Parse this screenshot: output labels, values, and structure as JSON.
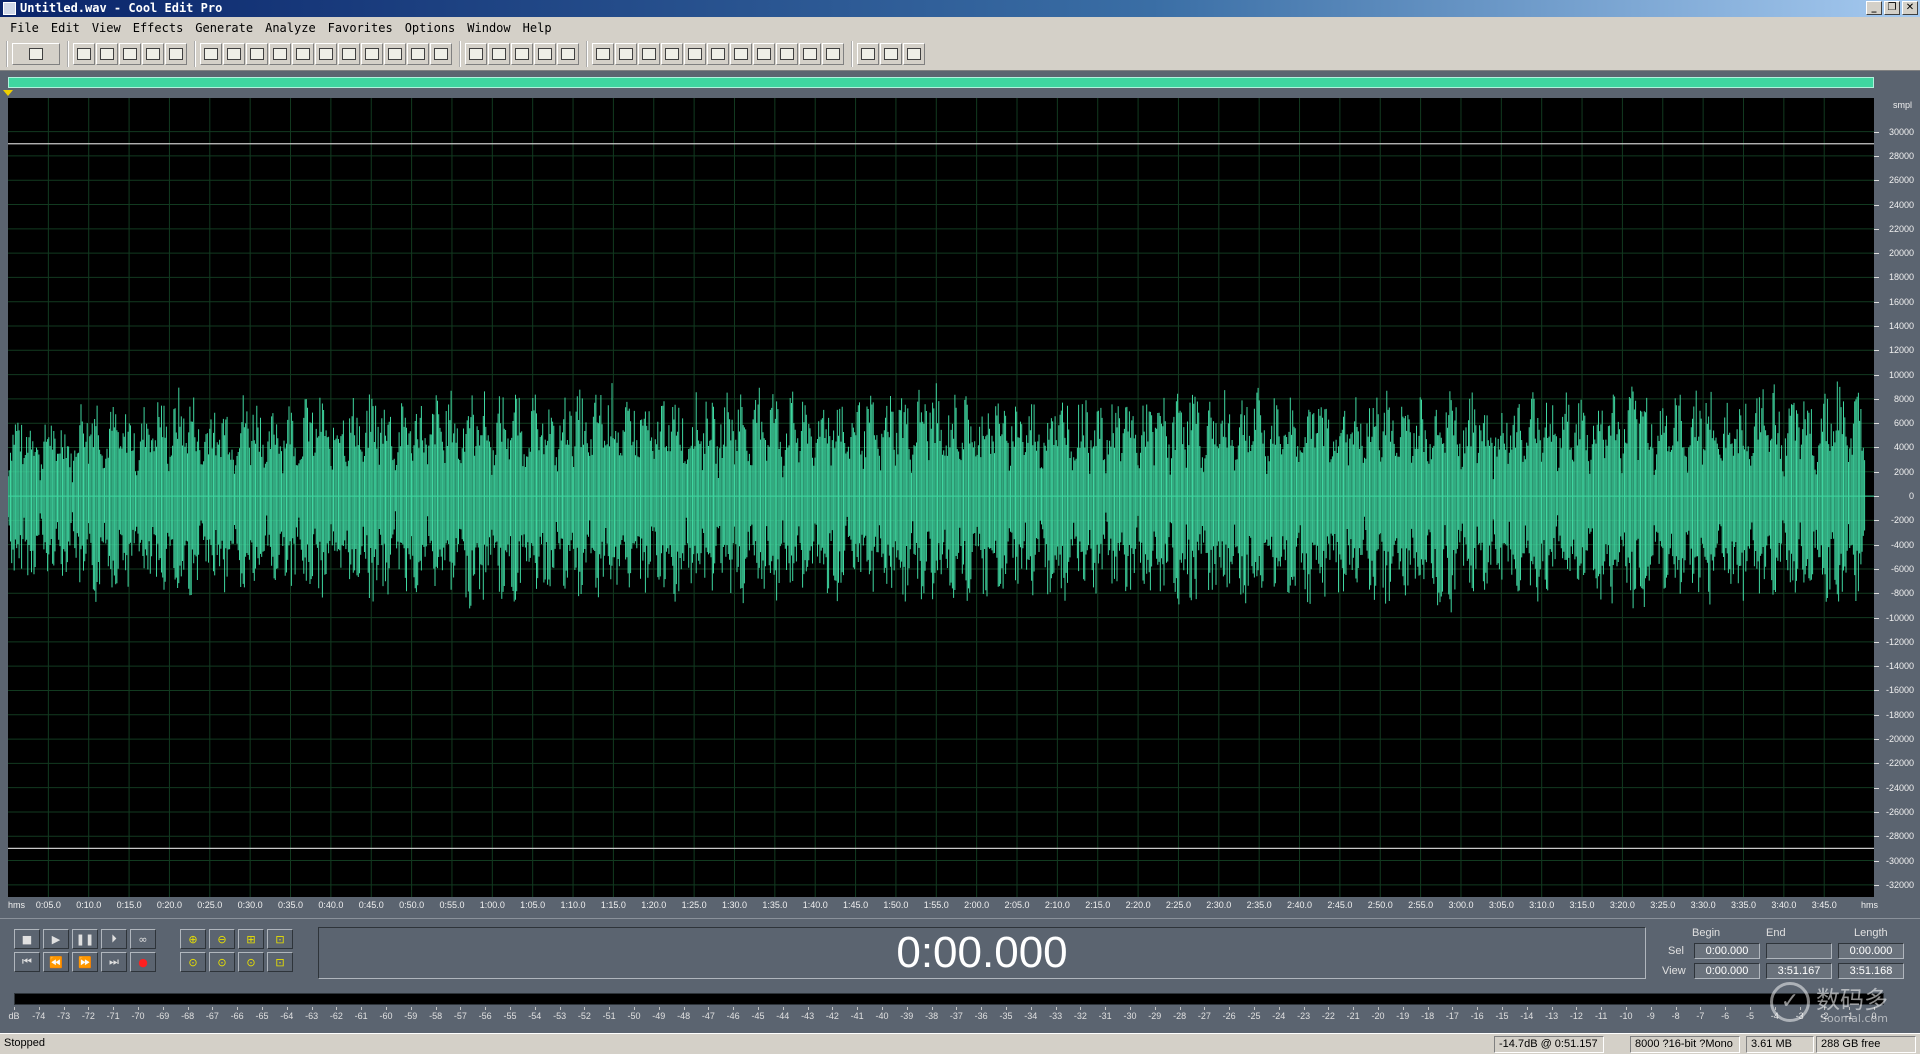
{
  "window": {
    "title": "Untitled.wav - Cool Edit Pro",
    "controls": [
      "_",
      "❐",
      "✕"
    ]
  },
  "menu": [
    "File",
    "Edit",
    "View",
    "Effects",
    "Generate",
    "Analyze",
    "Favorites",
    "Options",
    "Window",
    "Help"
  ],
  "toolbar": {
    "groups": [
      [
        "multitrack-toggle-icon"
      ],
      [
        "new-file-icon",
        "open-file-icon",
        "save-icon",
        "save-all-icon",
        "close-icon"
      ],
      [
        "undo-icon",
        "redo-icon",
        "repeat-last-icon",
        "copy-new-icon",
        "paste-new-icon",
        "cut-icon",
        "copy-icon",
        "paste-icon",
        "mix-paste-icon",
        "trim-icon",
        "ripple-delete-icon"
      ],
      [
        "envelope-icon",
        "waveform-icon",
        "spectral-view-icon",
        "spectral-pan-icon",
        "spectral-phase-icon"
      ],
      [
        "cue-list-icon",
        "play-list-icon",
        "info-icon",
        "preview-icon",
        "frequency-analysis-icon",
        "time-display-icon",
        "level-meter-icon",
        "snap-icon",
        "settings-icon",
        "scripts-icon",
        "help-icon"
      ],
      [
        "tools-icon",
        "properties-icon",
        "context-help-icon"
      ]
    ]
  },
  "ruler_y": {
    "unit": "smpl",
    "labels": [
      "30000",
      "28000",
      "26000",
      "24000",
      "22000",
      "20000",
      "18000",
      "16000",
      "14000",
      "12000",
      "10000",
      "8000",
      "6000",
      "4000",
      "2000",
      "0",
      "-2000",
      "-4000",
      "-6000",
      "-8000",
      "-10000",
      "-12000",
      "-14000",
      "-16000",
      "-18000",
      "-20000",
      "-22000",
      "-24000",
      "-26000",
      "-28000",
      "-30000",
      "-32000"
    ],
    "values": [
      30000,
      28000,
      26000,
      24000,
      22000,
      20000,
      18000,
      16000,
      14000,
      12000,
      10000,
      8000,
      6000,
      4000,
      2000,
      0,
      -2000,
      -4000,
      -6000,
      -8000,
      -10000,
      -12000,
      -14000,
      -16000,
      -18000,
      -20000,
      -22000,
      -24000,
      -26000,
      -28000,
      -30000,
      -32000
    ],
    "range": [
      -33000,
      32768
    ]
  },
  "ruler_x": {
    "start_label": "hms",
    "end_label": "hms",
    "labels": [
      "0:05.0",
      "0:10.0",
      "0:15.0",
      "0:20.0",
      "0:25.0",
      "0:30.0",
      "0:35.0",
      "0:40.0",
      "0:45.0",
      "0:50.0",
      "0:55.0",
      "1:00.0",
      "1:05.0",
      "1:10.0",
      "1:15.0",
      "1:20.0",
      "1:25.0",
      "1:30.0",
      "1:35.0",
      "1:40.0",
      "1:45.0",
      "1:50.0",
      "1:55.0",
      "2:00.0",
      "2:05.0",
      "2:10.0",
      "2:15.0",
      "2:20.0",
      "2:25.0",
      "2:30.0",
      "2:35.0",
      "2:40.0",
      "2:45.0",
      "2:50.0",
      "2:55.0",
      "3:00.0",
      "3:05.0",
      "3:10.0",
      "3:15.0",
      "3:20.0",
      "3:25.0",
      "3:30.0",
      "3:35.0",
      "3:40.0",
      "3:45.0"
    ],
    "seconds": [
      5,
      10,
      15,
      20,
      25,
      30,
      35,
      40,
      45,
      50,
      55,
      60,
      65,
      70,
      75,
      80,
      85,
      90,
      95,
      100,
      105,
      110,
      115,
      120,
      125,
      130,
      135,
      140,
      145,
      150,
      155,
      160,
      165,
      170,
      175,
      180,
      185,
      190,
      195,
      200,
      205,
      210,
      215,
      220,
      225
    ],
    "duration_seconds": 231.168
  },
  "waveform": {
    "colors": {
      "wave": "#3fd6a0",
      "background": "#000000",
      "grid": "#123a20",
      "limit_line": "#c8c8c8",
      "overview": "#3fd6a0"
    },
    "clip_lines": [
      29000,
      -29000
    ],
    "peak_envelope": [
      [
        0,
        6500
      ],
      [
        2,
        8200
      ],
      [
        4,
        6000
      ],
      [
        6,
        7800
      ],
      [
        8,
        5500
      ],
      [
        10,
        10800
      ],
      [
        12,
        7000
      ],
      [
        14,
        8600
      ],
      [
        16,
        6200
      ],
      [
        18,
        10000
      ],
      [
        20,
        7500
      ],
      [
        22,
        10500
      ],
      [
        24,
        6800
      ],
      [
        26,
        9000
      ],
      [
        28,
        7200
      ],
      [
        30,
        10200
      ],
      [
        32,
        6600
      ],
      [
        34,
        8800
      ],
      [
        36,
        7400
      ],
      [
        38,
        9800
      ],
      [
        40,
        6900
      ],
      [
        42,
        9400
      ],
      [
        44,
        7600
      ],
      [
        46,
        10400
      ],
      [
        48,
        7000
      ],
      [
        50,
        9600
      ],
      [
        52,
        7300
      ],
      [
        54,
        9900
      ],
      [
        56,
        7800
      ],
      [
        58,
        10600
      ],
      [
        60,
        7100
      ],
      [
        62,
        10300
      ],
      [
        64,
        7700
      ],
      [
        66,
        9500
      ],
      [
        68,
        7000
      ],
      [
        70,
        10100
      ],
      [
        72,
        7400
      ],
      [
        74,
        10700
      ],
      [
        76,
        8000
      ],
      [
        78,
        9300
      ],
      [
        80,
        7200
      ],
      [
        82,
        10200
      ],
      [
        84,
        7600
      ],
      [
        86,
        9700
      ],
      [
        88,
        7300
      ],
      [
        90,
        10400
      ],
      [
        92,
        7900
      ],
      [
        94,
        11000
      ],
      [
        96,
        7500
      ],
      [
        98,
        9800
      ],
      [
        100,
        7200
      ],
      [
        102,
        10300
      ],
      [
        104,
        7700
      ],
      [
        106,
        9600
      ],
      [
        108,
        7100
      ],
      [
        110,
        10500
      ],
      [
        112,
        7800
      ],
      [
        114,
        11200
      ],
      [
        116,
        7400
      ],
      [
        118,
        9900
      ],
      [
        120,
        7300
      ],
      [
        122,
        10100
      ],
      [
        124,
        7700
      ],
      [
        126,
        9400
      ],
      [
        128,
        7200
      ],
      [
        130,
        10300
      ],
      [
        132,
        7600
      ],
      [
        134,
        9800
      ],
      [
        136,
        7100
      ],
      [
        138,
        10200
      ],
      [
        140,
        7500
      ],
      [
        142,
        9600
      ],
      [
        144,
        7800
      ],
      [
        146,
        11100
      ],
      [
        148,
        7200
      ],
      [
        150,
        9900
      ],
      [
        152,
        7600
      ],
      [
        154,
        10400
      ],
      [
        156,
        7300
      ],
      [
        158,
        9700
      ],
      [
        160,
        7900
      ],
      [
        162,
        10200
      ],
      [
        164,
        7400
      ],
      [
        166,
        9500
      ],
      [
        168,
        7100
      ],
      [
        170,
        10600
      ],
      [
        172,
        7700
      ],
      [
        174,
        9800
      ],
      [
        176,
        7300
      ],
      [
        178,
        11300
      ],
      [
        180,
        7600
      ],
      [
        182,
        10000
      ],
      [
        184,
        7200
      ],
      [
        186,
        9400
      ],
      [
        188,
        7800
      ],
      [
        190,
        10700
      ],
      [
        192,
        7400
      ],
      [
        194,
        9900
      ],
      [
        196,
        7000
      ],
      [
        198,
        10300
      ],
      [
        200,
        7600
      ],
      [
        202,
        11000
      ],
      [
        204,
        7300
      ],
      [
        206,
        9600
      ],
      [
        208,
        7800
      ],
      [
        210,
        10500
      ],
      [
        212,
        7200
      ],
      [
        214,
        9800
      ],
      [
        216,
        7500
      ],
      [
        218,
        10900
      ],
      [
        220,
        7100
      ],
      [
        222,
        9700
      ],
      [
        224,
        7600
      ],
      [
        226,
        11500
      ],
      [
        228,
        8200
      ],
      [
        230,
        9500
      ],
      [
        231.168,
        0
      ]
    ]
  },
  "transport": {
    "row1": [
      "■",
      "▶",
      "❚❚",
      "⏵",
      "∞"
    ],
    "row1_names": [
      "stop-button",
      "play-button",
      "pause-button",
      "play-to-end-button",
      "loop-button"
    ],
    "row2": [
      "⏮",
      "⏪",
      "⏩",
      "⏭",
      "●"
    ],
    "row2_names": [
      "go-to-start-button",
      "rewind-button",
      "fast-forward-button",
      "go-to-end-button",
      "record-button"
    ],
    "zoom_row1": [
      "⊕",
      "⊖",
      "⊞",
      "⊡"
    ],
    "zoom_row1_names": [
      "zoom-in-full-button",
      "zoom-out-full-button",
      "zoom-out-button",
      "zoom-in-vertical-button"
    ],
    "zoom_row2": [
      "⊙",
      "⊙",
      "⊙",
      "⊡"
    ],
    "zoom_row2_names": [
      "zoom-to-left-button",
      "zoom-to-right-button",
      "zoom-to-selection-button",
      "zoom-out-vertical-button"
    ]
  },
  "time_display": "0:00.000",
  "selection": {
    "headers": [
      "Begin",
      "End",
      "Length"
    ],
    "sel_label": "Sel",
    "view_label": "View",
    "sel": [
      "0:00.000",
      "",
      "0:00.000"
    ],
    "view": [
      "0:00.000",
      "3:51.167",
      "3:51.168"
    ]
  },
  "level_meter": {
    "labels": [
      "dB",
      "-74",
      "-73",
      "-72",
      "-71",
      "-70",
      "-69",
      "-68",
      "-67",
      "-66",
      "-65",
      "-64",
      "-63",
      "-62",
      "-61",
      "-60",
      "-59",
      "-58",
      "-57",
      "-56",
      "-55",
      "-54",
      "-53",
      "-52",
      "-51",
      "-50",
      "-49",
      "-48",
      "-47",
      "-46",
      "-45",
      "-44",
      "-43",
      "-42",
      "-41",
      "-40",
      "-39",
      "-38",
      "-37",
      "-36",
      "-35",
      "-34",
      "-33",
      "-32",
      "-31",
      "-30",
      "-29",
      "-28",
      "-27",
      "-26",
      "-25",
      "-24",
      "-23",
      "-22",
      "-21",
      "-20",
      "-19",
      "-18",
      "-17",
      "-16",
      "-15",
      "-14",
      "-13",
      "-12",
      "-11",
      "-10",
      "-9",
      "-8",
      "-7",
      "-6",
      "-5",
      "-4",
      "-3",
      "-2",
      "-1",
      "0"
    ]
  },
  "status": {
    "state": "Stopped",
    "cursor": "-14.7dB @   0:51.157",
    "format": "8000 ?16-bit ?Mono",
    "size": "3.61 MB",
    "free": "288 GB free"
  },
  "watermark": {
    "text": "数码多",
    "sub": "Soomal.com"
  }
}
